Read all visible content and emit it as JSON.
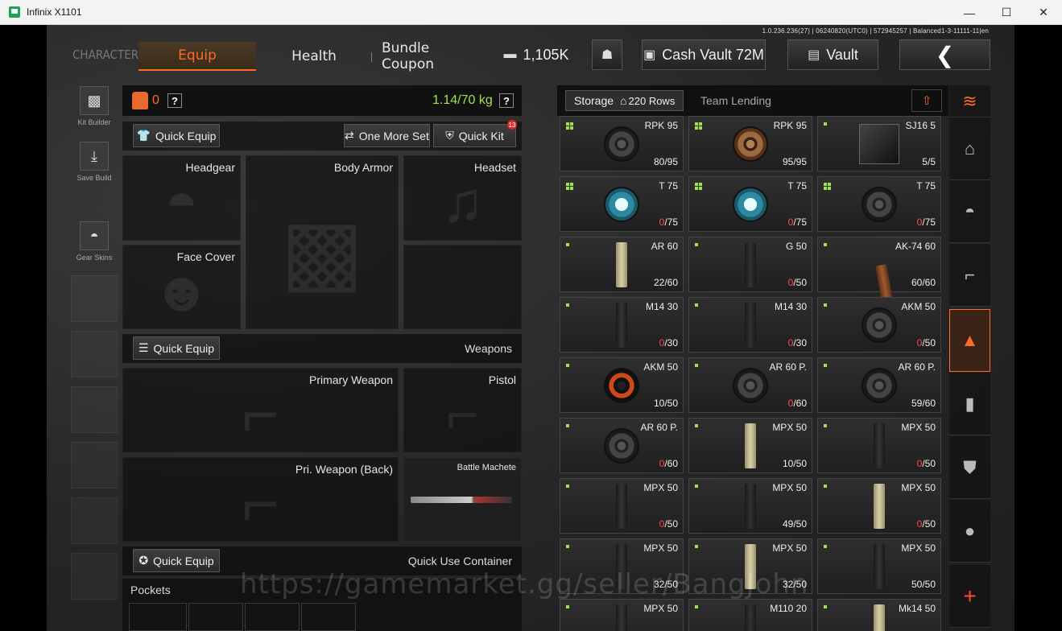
{
  "window": {
    "title": "Infinix X1101",
    "controls": [
      "—",
      "☐",
      "✕"
    ]
  },
  "version": "1.0.236.236(27) | 06240820(UTC0) | 572945257 | Balanced1-3-11111-11|en",
  "nav": {
    "character": "CHARACTER",
    "tabs": [
      "Equip",
      "Health",
      "Bundle Coupon"
    ],
    "currency": "1,105K",
    "cash_vault": "Cash Vault 72M",
    "vault": "Vault"
  },
  "left": {
    "kit_builder": "Kit Builder",
    "save_build": "Save Build",
    "gear_skins": "Gear Skins"
  },
  "equip": {
    "bag_count": "0",
    "weight": "1.14/70 kg",
    "quick_equip": "Quick Equip",
    "one_more_set": "One More Set",
    "quick_kit": "Quick Kit",
    "quick_kit_badge": "13",
    "slots": {
      "headgear": "Headgear",
      "body_armor": "Body Armor",
      "headset": "Headset",
      "face_cover": "Face Cover",
      "weapons": "Weapons",
      "primary": "Primary Weapon",
      "pistol": "Pistol",
      "pri_back": "Pri. Weapon (Back)",
      "melee": "Battle Machete",
      "quick_use": "Quick Use Container",
      "pockets": "Pockets"
    }
  },
  "storage": {
    "tab_storage": "Storage",
    "rows": "220 Rows",
    "tab_team": "Team Lending",
    "items": [
      {
        "name": "RPK 95",
        "have": "80",
        "cap": "/95",
        "zero": false,
        "art": "drum",
        "dots": 4
      },
      {
        "name": "RPK 95",
        "have": "95",
        "cap": "/95",
        "zero": false,
        "art": "drum rust",
        "dots": 4
      },
      {
        "name": "SJ16 5",
        "have": "5",
        "cap": "/5",
        "zero": false,
        "art": "box",
        "dots": 1
      },
      {
        "name": "T 75",
        "have": "0",
        "cap": "/75",
        "zero": true,
        "art": "drum blue",
        "dots": 4
      },
      {
        "name": "T 75",
        "have": "0",
        "cap": "/75",
        "zero": true,
        "art": "drum blue",
        "dots": 4
      },
      {
        "name": "T 75",
        "have": "0",
        "cap": "/75",
        "zero": true,
        "art": "drum",
        "dots": 4
      },
      {
        "name": "AR 60",
        "have": "22",
        "cap": "/60",
        "zero": false,
        "art": "stick tan",
        "dots": 1
      },
      {
        "name": "G 50",
        "have": "0",
        "cap": "/50",
        "zero": true,
        "art": "stick",
        "dots": 1
      },
      {
        "name": "AK-74 60",
        "have": "60",
        "cap": "/60",
        "zero": false,
        "art": "stick rust",
        "dots": 1
      },
      {
        "name": "M14 30",
        "have": "0",
        "cap": "/30",
        "zero": true,
        "art": "stick",
        "dots": 1
      },
      {
        "name": "M14 30",
        "have": "0",
        "cap": "/30",
        "zero": true,
        "art": "stick",
        "dots": 1
      },
      {
        "name": "AKM 50",
        "have": "0",
        "cap": "/50",
        "zero": true,
        "art": "drum",
        "dots": 1
      },
      {
        "name": "AKM 50",
        "have": "10",
        "cap": "/50",
        "zero": false,
        "art": "drum orange",
        "dots": 1
      },
      {
        "name": "AR 60 P.",
        "have": "0",
        "cap": "/60",
        "zero": true,
        "art": "drum",
        "dots": 1
      },
      {
        "name": "AR 60 P.",
        "have": "59",
        "cap": "/60",
        "zero": false,
        "art": "drum",
        "dots": 1
      },
      {
        "name": "AR 60 P.",
        "have": "0",
        "cap": "/60",
        "zero": true,
        "art": "drum",
        "dots": 1
      },
      {
        "name": "MPX 50",
        "have": "10",
        "cap": "/50",
        "zero": false,
        "art": "stick tan",
        "dots": 1
      },
      {
        "name": "MPX 50",
        "have": "0",
        "cap": "/50",
        "zero": true,
        "art": "stick",
        "dots": 1
      },
      {
        "name": "MPX 50",
        "have": "0",
        "cap": "/50",
        "zero": true,
        "art": "stick",
        "dots": 1
      },
      {
        "name": "MPX 50",
        "have": "49",
        "cap": "/50",
        "zero": false,
        "art": "stick",
        "dots": 1
      },
      {
        "name": "MPX 50",
        "have": "0",
        "cap": "/50",
        "zero": true,
        "art": "stick tan",
        "dots": 1
      },
      {
        "name": "MPX 50",
        "have": "32",
        "cap": "/50",
        "zero": false,
        "art": "stick",
        "dots": 1
      },
      {
        "name": "MPX 50",
        "have": "32",
        "cap": "/50",
        "zero": false,
        "art": "stick tan",
        "dots": 1
      },
      {
        "name": "MPX 50",
        "have": "50",
        "cap": "/50",
        "zero": false,
        "art": "stick",
        "dots": 1
      },
      {
        "name": "MPX 50",
        "have": "",
        "cap": "",
        "zero": false,
        "art": "stick",
        "dots": 1
      },
      {
        "name": "M110 20",
        "have": "",
        "cap": "",
        "zero": false,
        "art": "stick",
        "dots": 1
      },
      {
        "name": "Mk14 50",
        "have": "",
        "cap": "",
        "zero": false,
        "art": "stick tan",
        "dots": 1
      }
    ]
  },
  "watermark": "https://gamemarket.gg/seller/BangJohn"
}
